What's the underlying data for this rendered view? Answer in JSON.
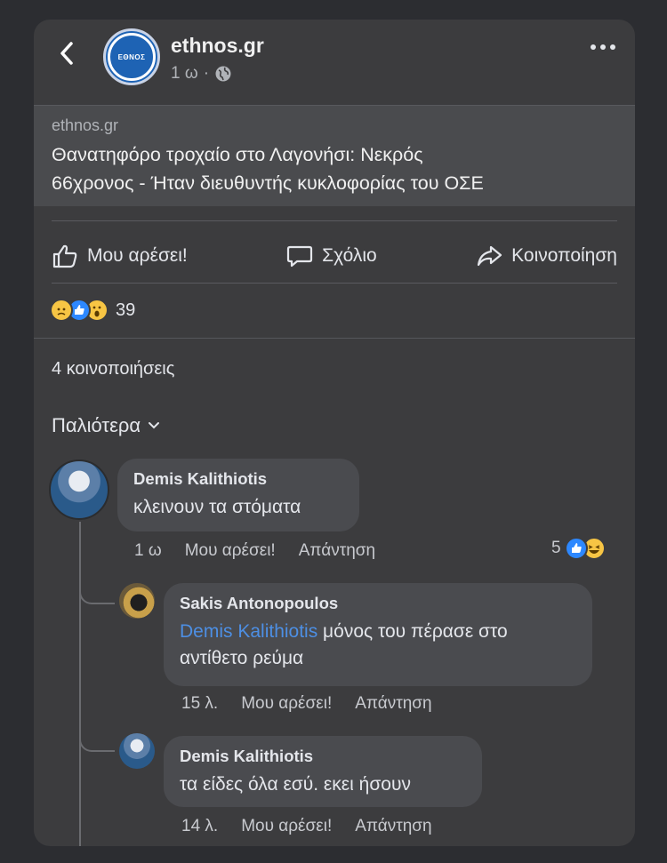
{
  "header": {
    "page_name": "ethnos.gr",
    "post_time": "1 ω",
    "dot": "·",
    "logo_text": "ΕΘΝΟΣ"
  },
  "link_card": {
    "domain": "ethnos.gr",
    "title_line1": "Θανατηφόρο τροχαίο στο Λαγονήσι: Νεκρός",
    "title_line2": "66χρονος - Ήταν διευθυντής κυκλοφορίας του ΟΣΕ"
  },
  "actions": {
    "like": "Μου αρέσει!",
    "comment": "Σχόλιο",
    "share": "Κοινοποίηση"
  },
  "reactions": {
    "icons": [
      "sad-icon",
      "like-icon",
      "wow-icon"
    ],
    "count": "39"
  },
  "shares": "4 κοινοποιήσεις",
  "sort_label": "Παλιότερα",
  "comments": [
    {
      "author": "Demis Kalithiotis",
      "text": "κλεινουν τα στόματα",
      "time": "1 ω",
      "like": "Μου αρέσει!",
      "reply": "Απάντηση",
      "reaction_count": "5",
      "reaction_icons": [
        "like-icon",
        "haha-icon"
      ]
    },
    {
      "author": "Sakis Antonopoulos",
      "mention": "Demis Kalithiotis",
      "text_after_mention": " μόνος του πέρασε στο",
      "text_line2": "αντίθετο ρεύμα",
      "time": "15 λ.",
      "like": "Μου αρέσει!",
      "reply": "Απάντηση"
    },
    {
      "author": "Demis Kalithiotis",
      "text": "τα είδες όλα εσύ. εκει ήσουν",
      "time": "14 λ.",
      "like": "Μου αρέσει!",
      "reply": "Απάντηση"
    }
  ],
  "colors": {
    "background": "#2c2d31",
    "panel": "#3c3c3e",
    "bubble": "#4a4b4f",
    "mention": "#4d8fe4",
    "like_blue": "#2d88ff",
    "reaction_yellow": "#f7c544"
  }
}
